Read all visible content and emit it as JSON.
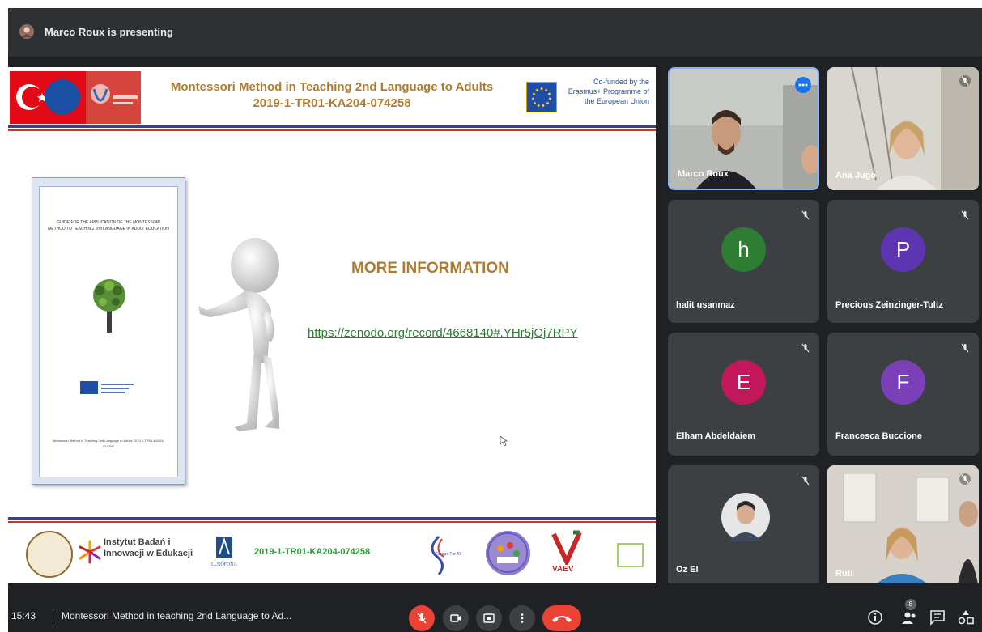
{
  "topbar": {
    "presenter_text": "Marco Roux is presenting",
    "icon": "presenter-avatar-icon"
  },
  "slide": {
    "title_line1": "Montessori Method in Teaching 2nd Language to Adults",
    "title_line2": "2019-1-TR01-KA204-074258",
    "cofunded": "Co-funded by the Erasmus+ Programme of the European Union",
    "guide_title": "GUIDE FOR THE APPLICATION OF THE MONTESSORI METHOD TO TEACHING 2nd LANGUAGE IN ADULT EDUCATION",
    "guide_footer": "Montessori Method in Teaching 2nd Language to Adults 2019-1-TR01-KA204-074258",
    "more_info": "MORE INFORMATION",
    "link": "https://zenodo.org/record/4668140#.YHr5jOj7RPY",
    "footer": {
      "ibi_line1": "Instytut Badań i",
      "ibi_line2": "Innowacji w Edukacji",
      "lusofona": "LUSÓFONA",
      "code": "2019-1-TR01-KA204-074258",
      "europe": "Europe For All",
      "vaev": "VAEV"
    }
  },
  "participants": [
    {
      "name": "Marco Roux",
      "kind": "video",
      "active": true
    },
    {
      "name": "Ana Jugo",
      "kind": "video",
      "muted": true
    },
    {
      "name": "halit usanmaz",
      "initial": "h",
      "color": "#2e7d32",
      "muted": true
    },
    {
      "name": "Precious Zeinzinger-Tultz",
      "initial": "P",
      "color": "#5e35b1",
      "muted": true
    },
    {
      "name": "Elham Abdeldaiem",
      "initial": "E",
      "color": "#c2185b",
      "muted": true
    },
    {
      "name": "Francesca Buccione",
      "initial": "F",
      "color": "#7b3fb8",
      "muted": true
    },
    {
      "name": "Oz El",
      "kind": "avatar-photo",
      "muted": true
    },
    {
      "name": "Ruti",
      "kind": "video",
      "muted": true
    }
  ],
  "bottombar": {
    "time": "15:43",
    "meeting_title": "Montessori Method in teaching 2nd Language to Ad...",
    "people_count": "8"
  },
  "colors": {
    "end_call": "#ea4335",
    "tile_bg": "#3c4043",
    "meet_bg": "#202124",
    "title_gold": "#b07a30",
    "link_green": "#2e7d32"
  }
}
